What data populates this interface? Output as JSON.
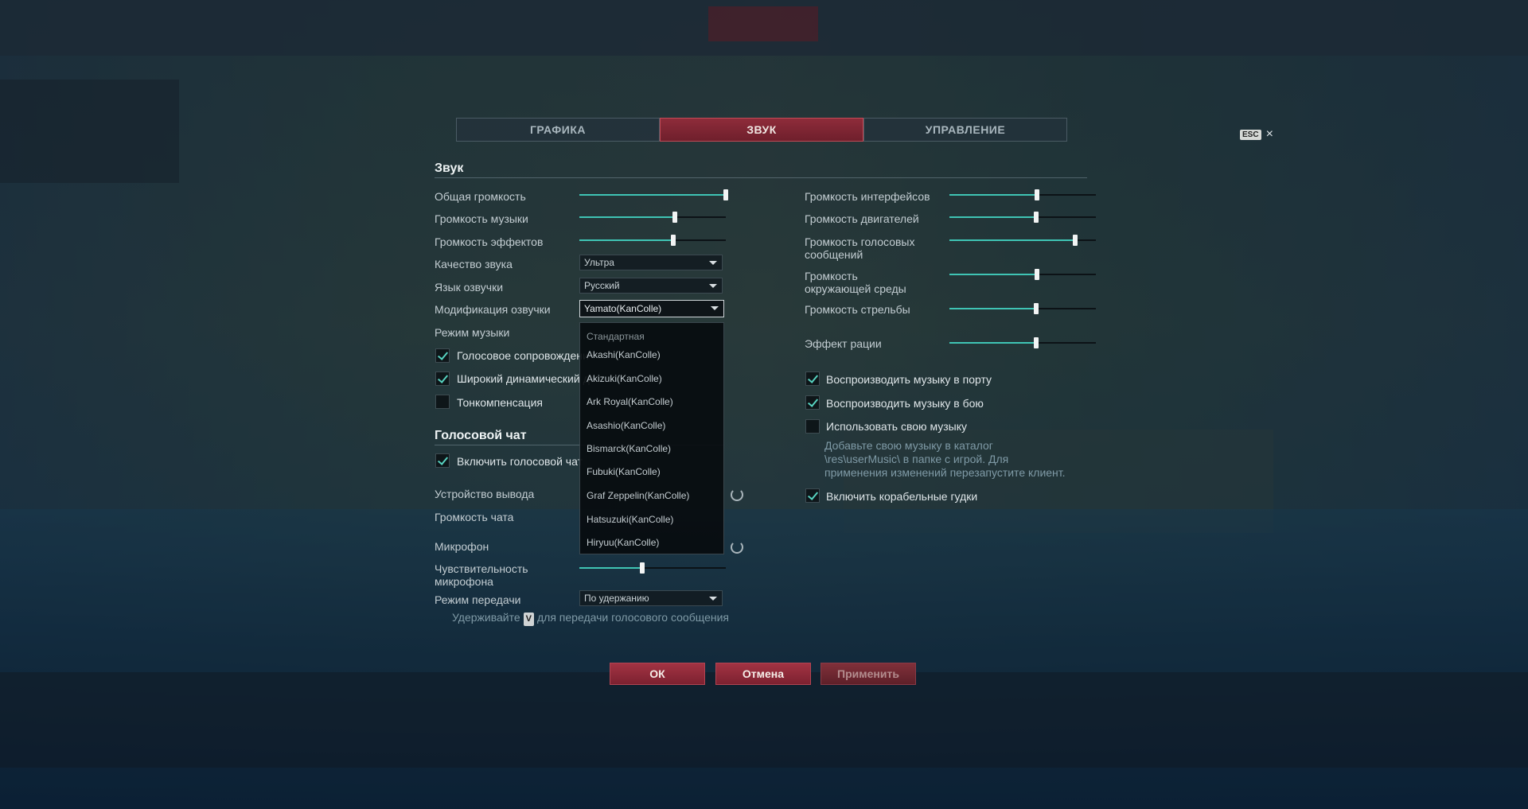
{
  "tabs": [
    {
      "label": "ГРАФИКА"
    },
    {
      "label": "ЗВУК"
    },
    {
      "label": "УПРАВЛЕНИЕ"
    }
  ],
  "esc": {
    "key": "ESC",
    "close": "×"
  },
  "sound": {
    "title": "Звук",
    "master_volume": {
      "label": "Общая громкость",
      "value": 1.0
    },
    "music_volume": {
      "label": "Громкость музыки",
      "value": 0.65
    },
    "effects_volume": {
      "label": "Громкость эффектов",
      "value": 0.64
    },
    "quality": {
      "label": "Качество звука",
      "value": "Ультра"
    },
    "voice_language": {
      "label": "Язык озвучки",
      "value": "Русский"
    },
    "voice_mod": {
      "label": "Модификация озвучки",
      "value": "Yamato(KanColle)"
    },
    "music_mode": {
      "label": "Режим музыки"
    },
    "voice_accompaniment": {
      "label": "Голосовое сопровождени",
      "checked": true
    },
    "wide_dynamic": {
      "label": "Широкий динамический д",
      "checked": true
    },
    "tone_compensation": {
      "label": "Тонкомпенсация",
      "checked": false
    }
  },
  "voice_mod_options": [
    "Стандартная",
    "Akashi(KanColle)",
    "Akizuki(KanColle)",
    "Ark Royal(KanColle)",
    "Asashio(KanColle)",
    "Bismarck(KanColle)",
    "Fubuki(KanColle)",
    "Graf Zeppelin(KanColle)",
    "Hatsuzuki(KanColle)",
    "Hiryuu(KanColle)"
  ],
  "voice_chat": {
    "title": "Голосовой чат",
    "enable": {
      "label": "Включить голосовой чат",
      "checked": true
    },
    "output_device": {
      "label": "Устройство вывода"
    },
    "chat_volume": {
      "label": "Громкость чата"
    },
    "microphone": {
      "label": "Микрофон"
    },
    "sensitivity": {
      "label": "Чувствительность микрофона",
      "value": 0.43
    },
    "transmission_mode": {
      "label": "Режим передачи",
      "value": "По удержанию"
    },
    "hint_before": "Удерживайте",
    "hint_key": "V",
    "hint_after": "для передачи голосового сообщения"
  },
  "right": {
    "interface_volume": {
      "label": "Громкость интерфейсов",
      "value": 0.6
    },
    "engine_volume": {
      "label": "Громкость двигателей",
      "value": 0.59
    },
    "voice_messages_volume": {
      "label": "Громкость голосовых сообщений",
      "value": 0.86
    },
    "ambient_volume": {
      "label": "Громкость окружающей среды",
      "value": 0.6
    },
    "shooting_volume": {
      "label": "Громкость стрельбы",
      "value": 0.59
    },
    "radio_effect": {
      "label": "Эффект рации",
      "value": 0.59
    },
    "music_in_port": {
      "label": "Воспроизводить музыку в порту",
      "checked": true
    },
    "music_in_battle": {
      "label": "Воспроизводить музыку в бою",
      "checked": true
    },
    "custom_music": {
      "label": "Использовать свою музыку",
      "checked": false
    },
    "custom_music_hint": "Добавьте свою музыку в каталог \\res\\userMusic\\ в папке с игрой. Для применения изменений перезапустите клиент.",
    "ship_horns": {
      "label": "Включить корабельные гудки",
      "checked": true
    }
  },
  "buttons": {
    "ok": "ОК",
    "cancel": "Отмена",
    "apply": "Применить"
  },
  "colors": {
    "accent": "#3fc4b4",
    "active_tab": "#8e2c3a",
    "button": "#a33343"
  }
}
